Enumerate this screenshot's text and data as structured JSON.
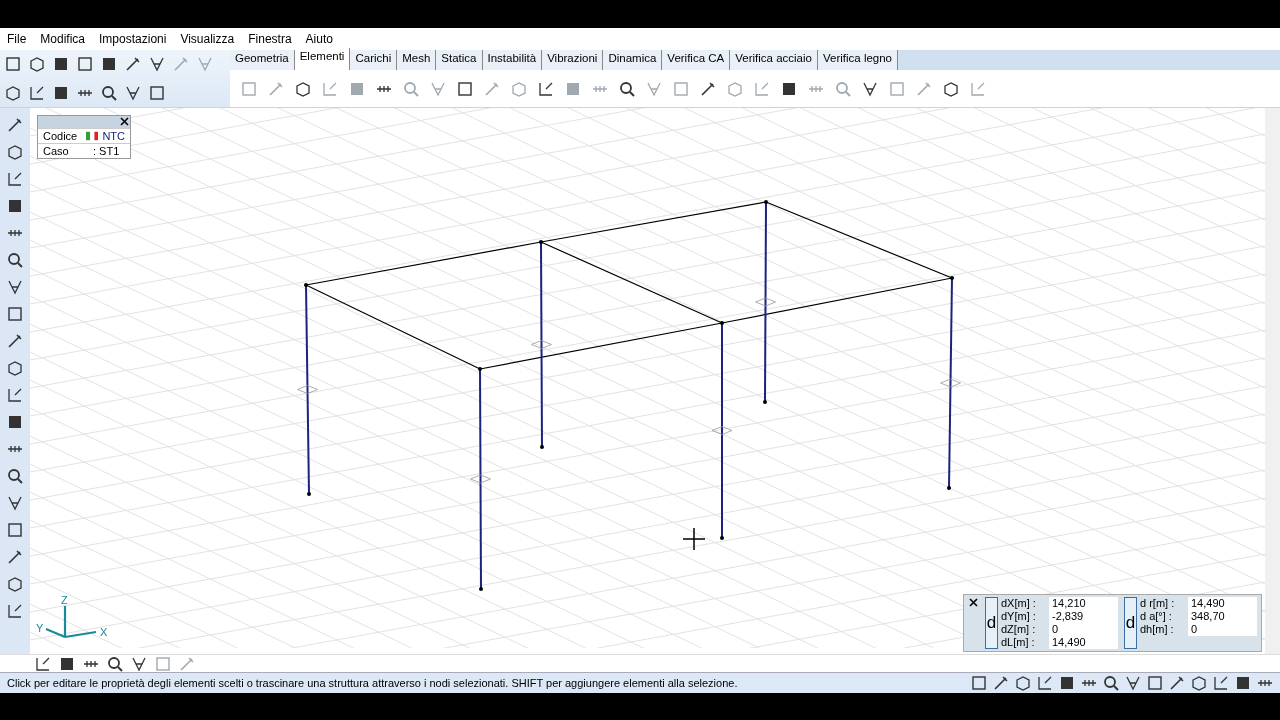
{
  "menu": [
    {
      "label": "File"
    },
    {
      "label": "Modifica"
    },
    {
      "label": "Impostazioni"
    },
    {
      "label": "Visualizza"
    },
    {
      "label": "Finestra"
    },
    {
      "label": "Aiuto"
    }
  ],
  "tabs": [
    {
      "label": "Geometria",
      "selected": false
    },
    {
      "label": "Elementi",
      "selected": true
    },
    {
      "label": "Carichi",
      "selected": false
    },
    {
      "label": "Mesh",
      "selected": false
    },
    {
      "label": "Statica",
      "selected": false
    },
    {
      "label": "Instabilità",
      "selected": false
    },
    {
      "label": "Vibrazioni",
      "selected": false
    },
    {
      "label": "Dinamica",
      "selected": false
    },
    {
      "label": "Verifica CA",
      "selected": false
    },
    {
      "label": "Verifica acciaio",
      "selected": false
    },
    {
      "label": "Verifica legno",
      "selected": false
    }
  ],
  "info_box": {
    "rows": [
      {
        "label": "Codice",
        "value": "NTC",
        "kind": "flag"
      },
      {
        "label": "Caso",
        "value": ": ST1",
        "kind": "plain"
      }
    ]
  },
  "axes": {
    "z": "Z",
    "y": "Y",
    "x": "X"
  },
  "measure": {
    "groups": [
      {
        "button": "d",
        "rows": [
          {
            "label": "dX[m] :",
            "value": "14,210"
          },
          {
            "label": "dY[m] :",
            "value": "-2,839"
          },
          {
            "label": "dZ[m] :",
            "value": "0"
          },
          {
            "label": "dL[m] :",
            "value": "14,490"
          }
        ]
      },
      {
        "button": "d",
        "rows": [
          {
            "label": "d r[m] :",
            "value": "14,490"
          },
          {
            "label": "d  a[°] :",
            "value": "348,70"
          },
          {
            "label": "dh[m] :",
            "value": "0"
          }
        ]
      }
    ]
  },
  "status_bar": {
    "message": "Click per editare le proprietà degli elementi scelti o trascinare una struttura attraverso i nodi selezionati. SHIFT per aggiungere elementi alla selezione."
  }
}
